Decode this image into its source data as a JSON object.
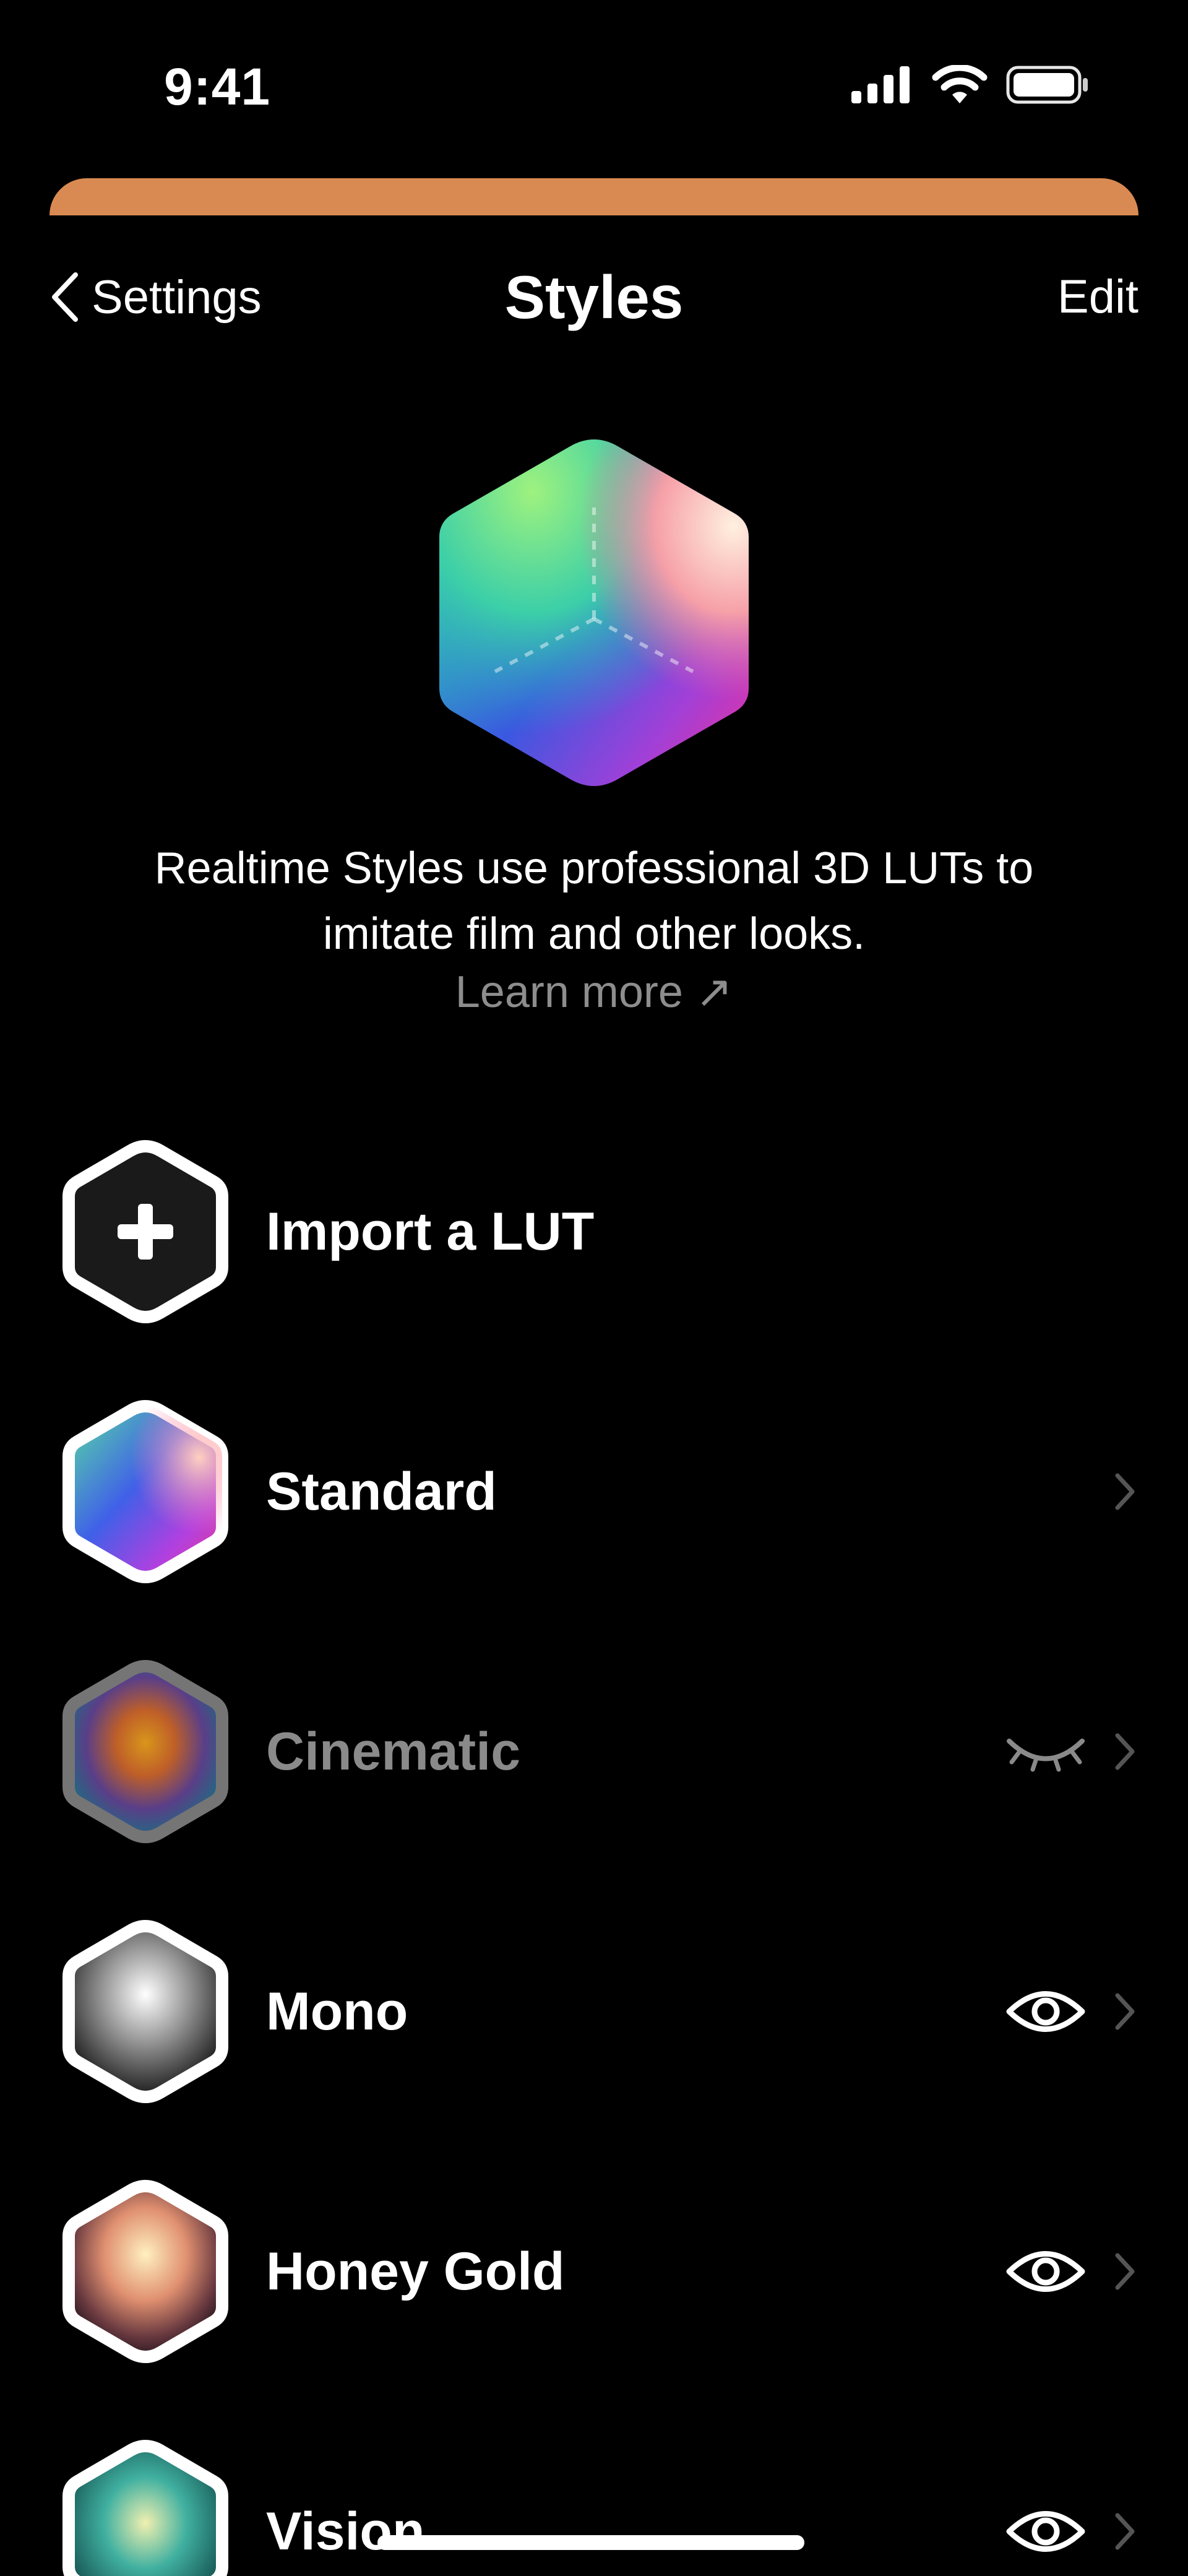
{
  "status_bar": {
    "time": "9:41"
  },
  "nav": {
    "back_label": "Settings",
    "title": "Styles",
    "edit_label": "Edit"
  },
  "hero": {
    "description_line1": "Realtime Styles use professional 3D LUTs to",
    "description_line2": "imitate film and other looks.",
    "learn_more": "Learn more ↗"
  },
  "styles": [
    {
      "label": "Import a LUT",
      "icon": "plus-hex-icon",
      "visibility": null,
      "chevron": false
    },
    {
      "label": "Standard",
      "icon": "standard-lut-icon",
      "visibility": null,
      "chevron": true
    },
    {
      "label": "Cinematic",
      "icon": "cinematic-lut-icon",
      "visibility": "hidden",
      "chevron": true
    },
    {
      "label": "Mono",
      "icon": "mono-lut-icon",
      "visibility": "visible",
      "chevron": true
    },
    {
      "label": "Honey Gold",
      "icon": "honey-gold-lut-icon",
      "visibility": "visible",
      "chevron": true
    },
    {
      "label": "Vision",
      "icon": "vision-lut-icon",
      "visibility": "visible",
      "chevron": true
    }
  ],
  "colors": {
    "background": "#000000",
    "sheet_accent": "#d98a52",
    "muted_text": "#8d8d8d"
  }
}
